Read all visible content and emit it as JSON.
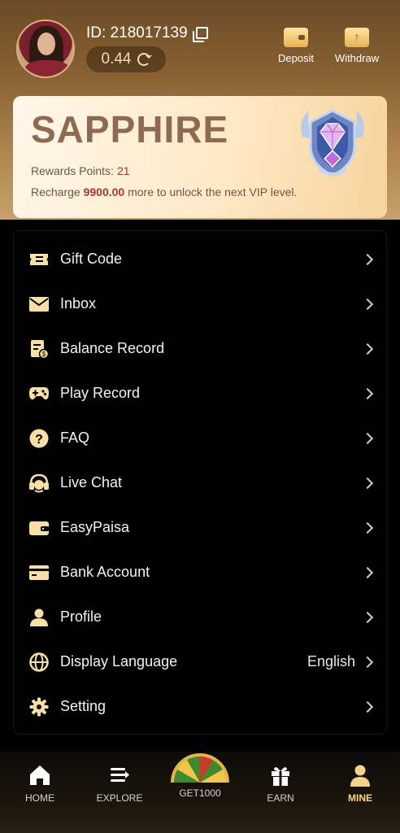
{
  "user": {
    "id_text": "ID: 218017139",
    "balance": "0.44"
  },
  "actions": [
    {
      "label": "Deposit",
      "icon": "wallet-icon"
    },
    {
      "label": "Withdraw",
      "icon": "withdraw-icon"
    }
  ],
  "vip": {
    "level": "SAPPHIRE",
    "points_label": "Rewards Points:",
    "points_value": "21",
    "recharge_prefix": "Recharge",
    "recharge_amount": "9900.00",
    "recharge_suffix": "more to unlock the next VIP level.",
    "badge_icon": "sapphire-diamond-badge"
  },
  "menu": [
    {
      "label": "Gift Code",
      "icon": "ticket-icon",
      "value": ""
    },
    {
      "label": "Inbox",
      "icon": "envelope-icon",
      "value": ""
    },
    {
      "label": "Balance Record",
      "icon": "receipt-icon",
      "value": ""
    },
    {
      "label": "Play Record",
      "icon": "gamepad-icon",
      "value": ""
    },
    {
      "label": "FAQ",
      "icon": "question-icon",
      "value": ""
    },
    {
      "label": "Live Chat",
      "icon": "headset-icon",
      "value": ""
    },
    {
      "label": "EasyPaisa",
      "icon": "wallet-icon",
      "value": ""
    },
    {
      "label": "Bank Account",
      "icon": "card-icon",
      "value": ""
    },
    {
      "label": "Profile",
      "icon": "person-icon",
      "value": ""
    },
    {
      "label": "Display Language",
      "icon": "globe-icon",
      "value": "English"
    },
    {
      "label": "Setting",
      "icon": "gear-icon",
      "value": ""
    }
  ],
  "nav": [
    {
      "label": "HOME",
      "icon": "home-icon",
      "active": false
    },
    {
      "label": "EXPLORE",
      "icon": "explore-icon",
      "active": false
    },
    {
      "label": "GET1000",
      "icon": "prize-wheel-icon",
      "active": false
    },
    {
      "label": "EARN",
      "icon": "gift-icon",
      "active": false
    },
    {
      "label": "MINE",
      "icon": "person-icon",
      "active": true
    }
  ],
  "colors": {
    "accent": "#f7dfa6",
    "header_top": "#6b4a26",
    "vip_title": "#8d6b52",
    "highlight_red": "#a8362c",
    "active_nav": "#f4d48c"
  }
}
